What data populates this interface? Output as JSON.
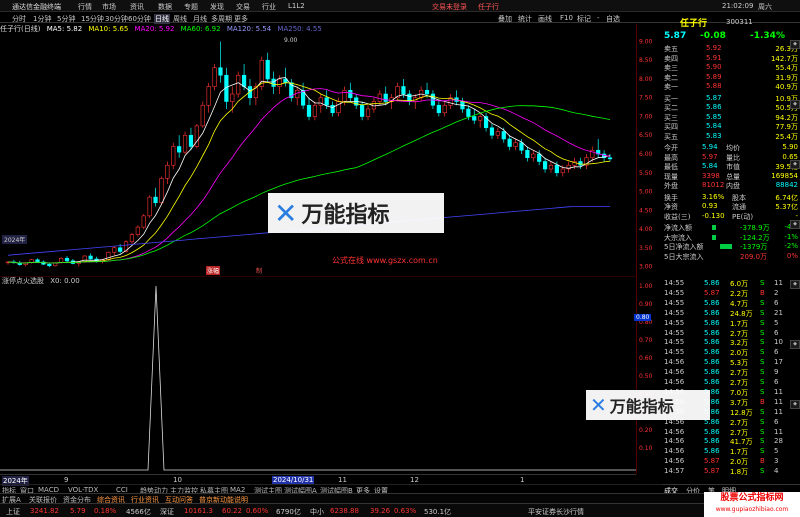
{
  "titlebar": {
    "app": "通达信金融终端",
    "menus": [
      "行情",
      "市场",
      "资讯",
      "数据",
      "专题",
      "发现",
      "交易",
      "行业",
      "L1L2"
    ],
    "trade_prompt": "交易未登录",
    "stock_btn": "任子行",
    "time": "21:02:09",
    "weekday": "周六"
  },
  "timeframes": [
    "分时",
    "1分钟",
    "5分钟",
    "15分钟",
    "30分钟",
    "60分钟",
    "日线",
    "周线",
    "月线",
    "多周期",
    "更多"
  ],
  "toolbar_right": [
    "叠加",
    "统计",
    "画线",
    "F10",
    "标记",
    "-",
    "自选"
  ],
  "ma_line": {
    "name": "任子行(日线)",
    "ma5": "MA5: 5.82",
    "ma10": "MA10: 5.65",
    "ma20": "MA20: 5.92",
    "ma60": "MA60: 6.92",
    "ma120": "MA120: 5.54",
    "ma250": "MA250: 4.55"
  },
  "main_chart": {
    "yticks": [
      "9.00",
      "8.50",
      "8.00",
      "7.50",
      "7.00",
      "6.50",
      "6.00",
      "5.50",
      "5.00",
      "4.50",
      "4.00",
      "3.50",
      "3.00"
    ],
    "y_range": [
      2.8,
      9.2
    ],
    "peak_label": "9.00",
    "badge_left": "2024年",
    "badge_mid": "涨幅",
    "badge_mid2": "制",
    "watermark": "公式在线  www.gszx.com.cn"
  },
  "candles": [
    [
      3.1,
      3.14,
      3.05,
      3.12
    ],
    [
      3.12,
      3.18,
      3.08,
      3.1
    ],
    [
      3.1,
      3.15,
      3.02,
      3.05
    ],
    [
      3.05,
      3.12,
      3.0,
      3.1
    ],
    [
      3.1,
      3.2,
      3.08,
      3.18
    ],
    [
      3.18,
      3.22,
      3.1,
      3.12
    ],
    [
      3.12,
      3.16,
      3.04,
      3.06
    ],
    [
      3.06,
      3.1,
      2.98,
      3.02
    ],
    [
      3.02,
      3.12,
      3.0,
      3.1
    ],
    [
      3.1,
      3.25,
      3.08,
      3.22
    ],
    [
      3.22,
      3.28,
      3.12,
      3.15
    ],
    [
      3.15,
      3.2,
      3.06,
      3.08
    ],
    [
      3.08,
      3.14,
      3.0,
      3.12
    ],
    [
      3.12,
      3.3,
      3.1,
      3.28
    ],
    [
      3.28,
      3.35,
      3.18,
      3.2
    ],
    [
      3.2,
      3.26,
      3.1,
      3.14
    ],
    [
      3.14,
      3.2,
      3.08,
      3.18
    ],
    [
      3.18,
      3.4,
      3.15,
      3.38
    ],
    [
      3.38,
      3.55,
      3.3,
      3.5
    ],
    [
      3.5,
      3.6,
      3.35,
      3.4
    ],
    [
      3.4,
      3.7,
      3.38,
      3.66
    ],
    [
      3.66,
      3.9,
      3.6,
      3.85
    ],
    [
      3.85,
      4.1,
      3.8,
      4.05
    ],
    [
      4.05,
      4.4,
      4.0,
      4.35
    ],
    [
      4.35,
      4.9,
      4.3,
      4.85
    ],
    [
      4.85,
      5.1,
      4.6,
      4.7
    ],
    [
      4.7,
      5.4,
      4.65,
      5.35
    ],
    [
      5.35,
      5.8,
      5.2,
      5.7
    ],
    [
      5.7,
      6.3,
      5.6,
      6.2
    ],
    [
      6.2,
      6.5,
      5.9,
      6.05
    ],
    [
      6.05,
      6.6,
      6.0,
      6.5
    ],
    [
      6.5,
      6.7,
      6.1,
      6.2
    ],
    [
      6.2,
      6.8,
      6.15,
      6.75
    ],
    [
      6.75,
      7.4,
      6.7,
      7.3
    ],
    [
      7.3,
      7.9,
      7.1,
      7.8
    ],
    [
      7.8,
      8.4,
      7.7,
      8.3
    ],
    [
      8.3,
      9.0,
      7.9,
      8.1
    ],
    [
      8.1,
      8.3,
      7.2,
      7.4
    ],
    [
      7.4,
      7.8,
      7.1,
      7.6
    ],
    [
      7.6,
      8.2,
      7.5,
      8.1
    ],
    [
      8.1,
      8.4,
      7.7,
      7.8
    ],
    [
      7.8,
      8.0,
      7.3,
      7.5
    ],
    [
      7.5,
      7.9,
      7.3,
      7.8
    ],
    [
      7.8,
      8.6,
      7.7,
      8.5
    ],
    [
      8.5,
      8.7,
      7.9,
      8.0
    ],
    [
      8.0,
      8.2,
      7.6,
      7.8
    ],
    [
      7.8,
      8.1,
      7.6,
      8.0
    ],
    [
      8.0,
      8.3,
      7.8,
      7.9
    ],
    [
      7.9,
      8.0,
      7.4,
      7.5
    ],
    [
      7.5,
      7.8,
      7.3,
      7.7
    ],
    [
      7.7,
      7.9,
      7.2,
      7.3
    ],
    [
      7.3,
      7.5,
      6.9,
      7.0
    ],
    [
      7.0,
      7.4,
      6.9,
      7.3
    ],
    [
      7.3,
      7.6,
      7.1,
      7.5
    ],
    [
      7.5,
      7.7,
      7.2,
      7.3
    ],
    [
      7.3,
      7.4,
      7.0,
      7.1
    ],
    [
      7.1,
      7.5,
      7.0,
      7.4
    ],
    [
      7.4,
      7.8,
      7.3,
      7.7
    ],
    [
      7.7,
      7.9,
      7.4,
      7.5
    ],
    [
      7.5,
      7.6,
      7.2,
      7.3
    ],
    [
      7.3,
      7.4,
      6.9,
      7.0
    ],
    [
      7.0,
      7.3,
      6.9,
      7.2
    ],
    [
      7.2,
      7.5,
      7.1,
      7.4
    ],
    [
      7.4,
      7.7,
      7.3,
      7.6
    ],
    [
      7.6,
      7.8,
      7.3,
      7.4
    ],
    [
      7.4,
      7.6,
      7.2,
      7.5
    ],
    [
      7.5,
      7.9,
      7.4,
      7.8
    ],
    [
      7.8,
      8.0,
      7.5,
      7.6
    ],
    [
      7.6,
      7.7,
      7.3,
      7.4
    ],
    [
      7.4,
      7.6,
      7.2,
      7.5
    ],
    [
      7.5,
      7.8,
      7.4,
      7.7
    ],
    [
      7.7,
      7.9,
      7.5,
      7.6
    ],
    [
      7.6,
      7.7,
      7.2,
      7.3
    ],
    [
      7.3,
      7.4,
      7.0,
      7.1
    ],
    [
      7.1,
      7.4,
      7.0,
      7.3
    ],
    [
      7.3,
      7.6,
      7.2,
      7.5
    ],
    [
      7.5,
      7.7,
      7.3,
      7.4
    ],
    [
      7.4,
      7.5,
      7.1,
      7.2
    ],
    [
      7.2,
      7.3,
      6.9,
      7.0
    ],
    [
      7.0,
      7.2,
      6.8,
      6.9
    ],
    [
      6.9,
      7.1,
      6.7,
      7.0
    ],
    [
      7.0,
      7.1,
      6.6,
      6.7
    ],
    [
      6.7,
      6.8,
      6.4,
      6.5
    ],
    [
      6.5,
      6.7,
      6.4,
      6.6
    ],
    [
      6.6,
      6.7,
      6.3,
      6.4
    ],
    [
      6.4,
      6.5,
      6.1,
      6.2
    ],
    [
      6.2,
      6.4,
      6.1,
      6.3
    ],
    [
      6.3,
      6.4,
      6.0,
      6.1
    ],
    [
      6.1,
      6.2,
      5.8,
      5.9
    ],
    [
      5.9,
      6.1,
      5.8,
      6.0
    ],
    [
      6.0,
      6.1,
      5.7,
      5.8
    ],
    [
      5.8,
      5.9,
      5.5,
      5.6
    ],
    [
      5.6,
      5.8,
      5.5,
      5.7
    ],
    [
      5.7,
      5.8,
      5.4,
      5.5
    ],
    [
      5.5,
      5.7,
      5.4,
      5.6
    ],
    [
      5.6,
      5.8,
      5.5,
      5.7
    ],
    [
      5.7,
      5.9,
      5.6,
      5.8
    ],
    [
      5.8,
      5.9,
      5.6,
      5.7
    ],
    [
      5.7,
      6.0,
      5.6,
      5.9
    ],
    [
      5.9,
      6.2,
      5.8,
      6.1
    ],
    [
      6.1,
      6.4,
      5.9,
      6.0
    ],
    [
      6.0,
      6.1,
      5.8,
      5.9
    ],
    [
      5.9,
      6.0,
      5.8,
      5.87
    ]
  ],
  "sub_chart": {
    "title": "涨停点火选股",
    "value": "X0: 0.00",
    "yticks": [
      "1.00",
      "0.90",
      "0.80",
      "0.70",
      "0.60",
      "0.50",
      "0.40",
      "0.30",
      "0.20",
      "0.10"
    ],
    "marker": "0.80"
  },
  "date_axis": [
    "2024年",
    "9",
    "10",
    "2024/10/31",
    "11",
    "12",
    "1"
  ],
  "indicator_tabs": [
    "指标",
    "窗口",
    "MACD",
    "VOL-TDX",
    "CCI",
    "趋势动力",
    "主力监控",
    "私募主图",
    "MA2",
    "测试主图",
    "测试幅图A",
    "测试幅图B",
    "更多",
    "设置"
  ],
  "bottom_tabs": [
    "扩展A",
    "关联报价",
    "资金分布",
    "综合资讯",
    "行业资讯",
    "互动问答",
    "普京新动能说明"
  ],
  "quote": {
    "name": "任子行",
    "code": "300311",
    "price": "5.87",
    "change": "-0.08",
    "pct": "-1.34%"
  },
  "asks": [
    [
      "卖五",
      "5.92",
      "26.3万"
    ],
    [
      "卖四",
      "5.91",
      "142.7万"
    ],
    [
      "卖三",
      "5.90",
      "55.4万"
    ],
    [
      "卖二",
      "5.89",
      "31.9万"
    ],
    [
      "卖一",
      "5.88",
      "40.9万"
    ]
  ],
  "bids": [
    [
      "买一",
      "5.87",
      "10.9万"
    ],
    [
      "买二",
      "5.86",
      "50.5万"
    ],
    [
      "买三",
      "5.85",
      "94.2万"
    ],
    [
      "买四",
      "5.84",
      "77.9万"
    ],
    [
      "买五",
      "5.83",
      "25.4万"
    ]
  ],
  "stats": [
    [
      "今开",
      "5.94",
      "均价",
      "5.90"
    ],
    [
      "最高",
      "5.97",
      "量比",
      "0.65"
    ],
    [
      "最低",
      "5.84",
      "市值",
      "39.5亿"
    ],
    [
      "现量",
      "3398",
      "总量",
      "169854"
    ],
    [
      "外盘",
      "81012",
      "内盘",
      "88842"
    ]
  ],
  "stats2": [
    [
      "换手",
      "3.16%",
      "股本",
      "6.74亿"
    ],
    [
      "净资",
      "0.93",
      "流通",
      "5.37亿"
    ],
    [
      "收益(三)",
      "-0.130",
      "PE(动)",
      "-"
    ]
  ],
  "flows": [
    [
      "净流入额",
      "-378.9万",
      "-4%"
    ],
    [
      "大宗流入",
      "-124.2万",
      "-1%"
    ],
    [
      "5日净流入额",
      "-1379万",
      "-2%"
    ],
    [
      "5日大宗流入",
      "209.0万",
      "0%"
    ]
  ],
  "ticks": [
    [
      "14:55",
      "5.86",
      "6.0万",
      "S",
      "11"
    ],
    [
      "14:55",
      "5.87",
      "2.2万",
      "B",
      "2"
    ],
    [
      "14:55",
      "5.86",
      "4.7万",
      "S",
      "6"
    ],
    [
      "14:55",
      "5.86",
      "24.8万",
      "S",
      "21"
    ],
    [
      "14:55",
      "5.86",
      "1.7万",
      "S",
      "5"
    ],
    [
      "14:55",
      "5.86",
      "2.7万",
      "S",
      "6"
    ],
    [
      "14:55",
      "5.86",
      "3.2万",
      "S",
      "10"
    ],
    [
      "14:55",
      "5.86",
      "2.0万",
      "S",
      "6"
    ],
    [
      "14:56",
      "5.86",
      "5.3万",
      "S",
      "17"
    ],
    [
      "14:56",
      "5.86",
      "2.7万",
      "S",
      "9"
    ],
    [
      "14:56",
      "5.86",
      "2.7万",
      "S",
      "6"
    ],
    [
      "14:56",
      "5.86",
      "7.0万",
      "S",
      "11"
    ],
    [
      "14:56",
      "5.86",
      "3.7万",
      "B",
      "11"
    ],
    [
      "14:56",
      "5.86",
      "12.8万",
      "S",
      "11"
    ],
    [
      "14:56",
      "5.86",
      "2.7万",
      "S",
      "6"
    ],
    [
      "14:56",
      "5.86",
      "2.7万",
      "S",
      "11"
    ],
    [
      "14:56",
      "5.86",
      "41.7万",
      "S",
      "28"
    ],
    [
      "14:56",
      "5.86",
      "1.7万",
      "S",
      "5"
    ],
    [
      "14:56",
      "5.87",
      "2.0万",
      "B",
      "3"
    ],
    [
      "14:57",
      "5.87",
      "1.8万",
      "S",
      "4"
    ]
  ],
  "right_tabs": [
    "成交",
    "分价",
    "笔",
    "明细"
  ],
  "status": {
    "sh_label": "上证",
    "sh_val": "3241.82",
    "sh_pct": "5.79",
    "sh_chg": "0.18%",
    "sh_amt": "4566亿",
    "sz_label": "深证",
    "sz_val": "10161.3",
    "sz_pct": "60.22",
    "sz_chg": "0.60%",
    "sz_amt": "6790亿",
    "zx_label": "中小",
    "zx_val": "6238.88",
    "zx_pct": "39.26",
    "zx_chg": "0.63%",
    "zx_amt": "530.1亿",
    "broker": "平安证券长沙行情"
  },
  "logo": {
    "text": "万能指标"
  },
  "site_badge": "股票公式指标网",
  "site_url": "www.gupiaozhibiao.com",
  "colors": {
    "up": "#ff3333",
    "down": "#00ffff",
    "ma5": "#ffffff",
    "ma10": "#ffff00",
    "ma20": "#ff00ff",
    "ma60": "#00ff00",
    "ma120": "#4444ff"
  }
}
